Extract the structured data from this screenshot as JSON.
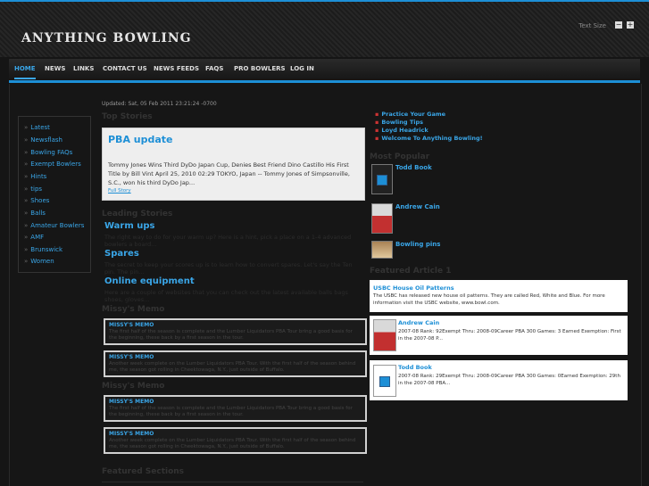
{
  "site": {
    "title": "ANYTHING BOWLING",
    "text_size_label": "Text Size"
  },
  "nav": [
    {
      "label": "HOME"
    },
    {
      "label": "NEWS"
    },
    {
      "label": "LINKS"
    },
    {
      "label": "CONTACT US"
    },
    {
      "label": "NEWS FEEDS"
    },
    {
      "label": "FAQS"
    },
    {
      "label": "PRO BOWLERS"
    },
    {
      "label": "LOG IN"
    }
  ],
  "sidebar": {
    "items": [
      {
        "label": "Latest"
      },
      {
        "label": "Newsflash"
      },
      {
        "label": "Bowling FAQs"
      },
      {
        "label": "Exempt Bowlers"
      },
      {
        "label": "Hints"
      },
      {
        "label": "tips"
      },
      {
        "label": "Shoes"
      },
      {
        "label": "Balls"
      },
      {
        "label": "Amateur Bowlers"
      },
      {
        "label": "AMF"
      },
      {
        "label": "Brunswick"
      },
      {
        "label": "Women"
      }
    ]
  },
  "main": {
    "updated": "Updated: Sat, 05 Feb 2011 23:21:24 -0700",
    "top_stories_heading": "Top Stories",
    "pba": {
      "title": "PBA update",
      "body": "Tommy Jones Wins Third DyDo Japan Cup, Denies Best Friend Dino Castillo His First Title by Bill Vint April 25, 2010 02:29 TOKYO, Japan -- Tommy Jones of Simpsonville, S.C., won his third DyDo Jap...",
      "more": "Full Story"
    },
    "leading_heading": "Leading Stories",
    "leading": [
      {
        "title": "Warm ups",
        "desc": "The right way to do for your warm up? Here is a hint, pick a place on a 1-4 advanced bowlers a board..."
      },
      {
        "title": "Spares",
        "desc": "The secret to keep your scores up is to learn how to convert spares. Let's say the Ten pin. The pin..."
      },
      {
        "title": "Online equipment",
        "desc": "Here are a couple of websites that you can check out the latest available balls bags shoes, gloves..."
      }
    ],
    "missy_heading_1": "Missy's Memo",
    "missy_heading_2": "Missy's Memo",
    "memos": [
      {
        "title": "MISSY'S MEMO",
        "desc": "The first half of the season is complete and the Lumber Liquidators PBA Tour bring a good basis for the beginning, these back by a first season in the tour."
      },
      {
        "title": "MISSY'S MEMO",
        "desc": "Another week complete on the Lumber Liquidators PBA Tour. With the first half of the season behind me, the season got rolling in Cheektowaga, N.Y., just outside of Buffalo."
      },
      {
        "title": "MISSY'S MEMO",
        "desc": "The first half of the season is complete and the Lumber Liquidators PBA Tour bring a good basis for the beginning, these back by a first season in the tour."
      },
      {
        "title": "MISSY'S MEMO",
        "desc": "Another week complete on the Lumber Liquidators PBA Tour. With the first half of the season behind me, the season got rolling in Cheektowaga, N.Y., just outside of Buffalo."
      }
    ],
    "featured_heading": "Featured Sections"
  },
  "right": {
    "links": [
      {
        "label": "Practice Your Game"
      },
      {
        "label": "Bowling Tips"
      },
      {
        "label": "Loyd Headrick"
      },
      {
        "label": "Welcome To Anything Bowling!"
      }
    ],
    "most_popular_heading": "Most Popular",
    "popular": [
      {
        "name": "Todd Book",
        "icon": "doc-icon"
      },
      {
        "name": "Andrew Cain",
        "icon": "person-photo"
      },
      {
        "name": "Bowling pins",
        "icon": "pins-photo"
      }
    ],
    "featured_heading": "Featured Article 1",
    "usbc": {
      "title": "USBC House Oil Patterns",
      "desc": "The USBC has released new house oil patterns. They are called Red, White and Blue. For more information visit the USBC website, www.bowl.com."
    },
    "cards": [
      {
        "name": "Andrew Cain",
        "desc": "2007-08 Rank: 92Exempt Thru: 2008-09Career PBA 300 Games: 3 Earned Exemption: First in the 2007-08 P..."
      },
      {
        "name": "Todd Book",
        "desc": "2007-08 Rank: 29Exempt Thru: 2008-09Career PBA 300 Games: 0Earned Exemption: 29th in the 2007-08 PBA..."
      }
    ]
  },
  "colors": {
    "accent": "#1d8fd6",
    "bullet_red": "#cc3333",
    "bg": "#151515"
  }
}
